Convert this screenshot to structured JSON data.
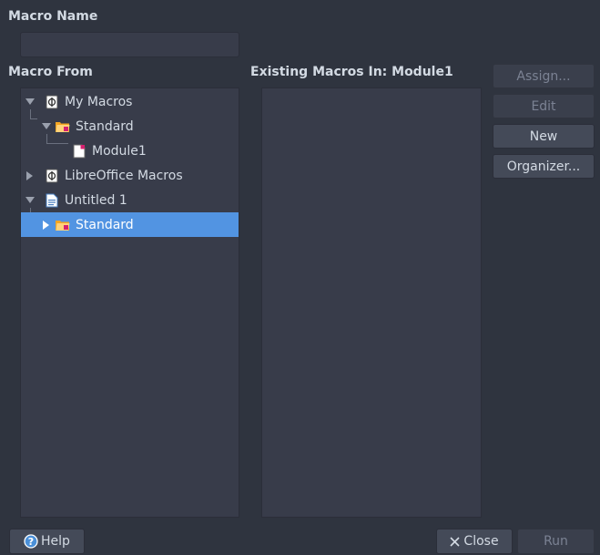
{
  "macro_name": {
    "label": "Macro Name",
    "value": ""
  },
  "macro_from": {
    "label": "Macro From",
    "tree": [
      {
        "label": "My Macros",
        "icon": "macro-library-icon",
        "expanded": true
      },
      {
        "label": "Standard",
        "icon": "macro-folder-icon",
        "expanded": true
      },
      {
        "label": "Module1",
        "icon": "macro-module-icon"
      },
      {
        "label": "LibreOffice Macros",
        "icon": "macro-library-icon",
        "expanded": false
      },
      {
        "label": "Untitled 1",
        "icon": "document-icon",
        "expanded": true
      },
      {
        "label": "Standard",
        "icon": "macro-folder-icon",
        "expanded": false,
        "selected": true
      }
    ]
  },
  "existing_macros": {
    "label": "Existing Macros In: Module1",
    "items": []
  },
  "buttons": {
    "assign": "Assign...",
    "edit": "Edit",
    "new": "New",
    "organizer": "Organizer...",
    "help": "Help",
    "close": "Close",
    "run": "Run"
  },
  "colors": {
    "background": "#2f343f",
    "panel": "#383c4a",
    "selection": "#5294e2",
    "text": "#d3dae3",
    "disabled_text": "#7b8293"
  }
}
